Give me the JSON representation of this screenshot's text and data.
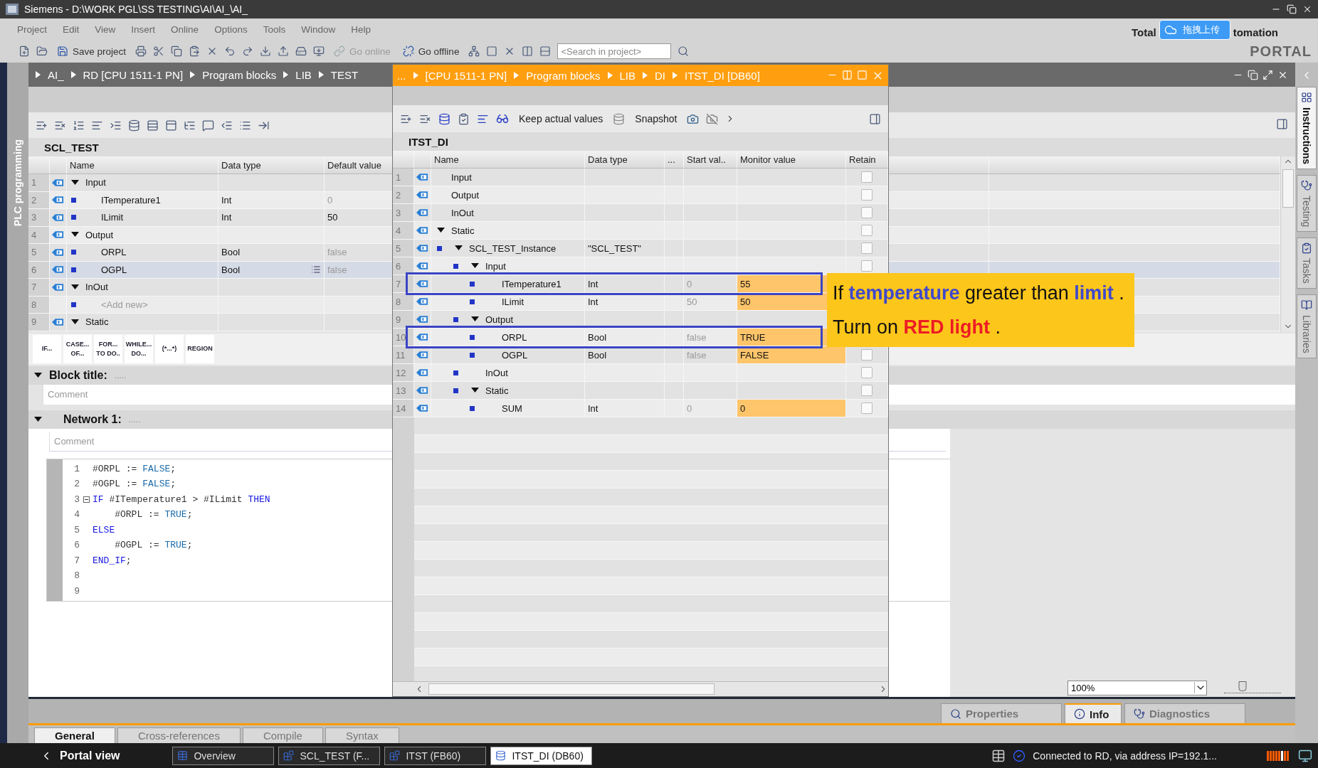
{
  "window": {
    "title": "Siemens - D:\\WORK PGL\\SS TESTING\\AI\\AI_\\AI_"
  },
  "menu": [
    "Project",
    "Edit",
    "View",
    "Insert",
    "Online",
    "Options",
    "Tools",
    "Window",
    "Help"
  ],
  "brand": {
    "left": "Total",
    "right": "tomation",
    "product": "PORTAL"
  },
  "upload_badge": {
    "label": "拖拽上传"
  },
  "toolbar": {
    "buttons": [
      {
        "kind": "save",
        "label": "Save project",
        "disabled": false
      },
      {
        "kind": "online",
        "label": "Go online",
        "disabled": true
      },
      {
        "kind": "offline",
        "label": "Go offline",
        "disabled": false
      }
    ],
    "search": {
      "placeholder": "<Search in project>"
    }
  },
  "side_left": {
    "label": "PLC programming"
  },
  "side_tabs": [
    {
      "kind": "instructions",
      "label": "Instructions",
      "selected": true
    },
    {
      "kind": "testing",
      "label": "Testing",
      "selected": false
    },
    {
      "kind": "tasks",
      "label": "Tasks",
      "selected": false
    },
    {
      "kind": "libraries",
      "label": "Libraries",
      "selected": false
    }
  ],
  "editor": {
    "breadcrumb": [
      "AI_",
      "RD [CPU 1511-1 PN]",
      "Program blocks",
      "LIB",
      "TEST"
    ],
    "block_name": "SCL_TEST",
    "columns": [
      "Name",
      "Data type",
      "Default value"
    ],
    "rows": [
      {
        "number": "1",
        "name": "Input",
        "expanded": true,
        "selected": false,
        "children": [
          {
            "number": "2",
            "kind": "member",
            "name": "ITemperature1",
            "data_type": "Int",
            "default_value": "0",
            "selected": false
          },
          {
            "number": "3",
            "kind": "member",
            "name": "ILimit",
            "data_type": "Int",
            "default_value": "50",
            "selected": false
          }
        ]
      },
      {
        "number": "4",
        "name": "Output",
        "expanded": true,
        "selected": false,
        "children": [
          {
            "number": "5",
            "kind": "member",
            "name": "ORPL",
            "data_type": "Bool",
            "default_value": "false",
            "selected": false
          },
          {
            "number": "6",
            "kind": "member",
            "name": "OGPL",
            "data_type": "Bool",
            "default_value": "false",
            "selected": true
          }
        ]
      },
      {
        "number": "7",
        "name": "InOut",
        "expanded": true,
        "selected": false,
        "children": [
          {
            "number": "8",
            "kind": "add_new",
            "name": "<Add new>",
            "selected": false
          }
        ]
      },
      {
        "number": "9",
        "name": "Static",
        "expanded": true,
        "selected": false
      }
    ],
    "instructions": [
      "IF...",
      "CASE...\nOF...",
      "FOR...\nTO DO..",
      "WHILE...\nDO...",
      "(*...*)",
      "REGION"
    ],
    "block_title": {
      "label": "Block title:",
      "value": ".....",
      "comment_placeholder": "Comment"
    },
    "network": {
      "label": "Network 1:",
      "value": ".....",
      "comment_placeholder": "Comment"
    },
    "code": [
      {
        "number": "1",
        "fold": false,
        "indent": false,
        "tokens": [
          {
            "kind": "var",
            "text": "#ORPL"
          },
          {
            "kind": "plain",
            "text": " := "
          },
          {
            "kind": "const",
            "text": "FALSE"
          },
          {
            "kind": "plain",
            "text": ";"
          }
        ]
      },
      {
        "number": "2",
        "fold": false,
        "indent": false,
        "tokens": [
          {
            "kind": "var",
            "text": "#OGPL"
          },
          {
            "kind": "plain",
            "text": " := "
          },
          {
            "kind": "const",
            "text": "FALSE"
          },
          {
            "kind": "plain",
            "text": ";"
          }
        ]
      },
      {
        "number": "3",
        "fold": true,
        "indent": false,
        "tokens": [
          {
            "kind": "keyword",
            "text": "IF"
          },
          {
            "kind": "var",
            "text": " #ITemperature1"
          },
          {
            "kind": "plain",
            "text": " > "
          },
          {
            "kind": "var",
            "text": "#ILimit"
          },
          {
            "kind": "keyword",
            "text": " THEN"
          }
        ]
      },
      {
        "number": "4",
        "fold": false,
        "indent": true,
        "tokens": [
          {
            "kind": "var",
            "text": "#ORPL"
          },
          {
            "kind": "plain",
            "text": " := "
          },
          {
            "kind": "const",
            "text": "TRUE"
          },
          {
            "kind": "plain",
            "text": ";"
          }
        ]
      },
      {
        "number": "5",
        "fold": false,
        "indent": false,
        "tokens": [
          {
            "kind": "keyword",
            "text": "ELSE"
          }
        ]
      },
      {
        "number": "6",
        "fold": false,
        "indent": true,
        "tokens": [
          {
            "kind": "var",
            "text": "#OGPL"
          },
          {
            "kind": "plain",
            "text": " := "
          },
          {
            "kind": "const",
            "text": "TRUE"
          },
          {
            "kind": "plain",
            "text": ";"
          }
        ]
      },
      {
        "number": "7",
        "fold": false,
        "indent": false,
        "tokens": [
          {
            "kind": "keyword",
            "text": "END_IF"
          },
          {
            "kind": "plain",
            "text": ";"
          }
        ]
      },
      {
        "number": "8",
        "fold": false
      },
      {
        "number": "9",
        "fold": false
      }
    ],
    "zoom": {
      "value": "100%",
      "level": 0.33
    }
  },
  "db_window": {
    "breadcrumb": [
      "...",
      "[CPU 1511-1 PN]",
      "Program blocks",
      "LIB",
      "DI",
      "ITST_DI [DB60]"
    ],
    "toolbar": {
      "keep": "Keep actual values",
      "snapshot": "Snapshot"
    },
    "block_name": "ITST_DI",
    "columns": [
      "Name",
      "Data type",
      "...",
      "Start val..",
      "Monitor value",
      "Retain"
    ],
    "rows": [
      {
        "number": "1",
        "name": "Input",
        "highlighted": false,
        "retain": false
      },
      {
        "number": "2",
        "name": "Output",
        "highlighted": false,
        "retain": false
      },
      {
        "number": "3",
        "name": "InOut",
        "highlighted": false,
        "retain": false
      },
      {
        "number": "4",
        "name": "Static",
        "expanded": true,
        "highlighted": false,
        "retain": false,
        "children": [
          {
            "number": "5",
            "name": "SCL_TEST_Instance",
            "data_type": "\"SCL_TEST\"",
            "expanded": true,
            "highlighted": false,
            "retain": false,
            "children": [
              {
                "number": "6",
                "name": "Input",
                "expanded": true,
                "highlighted": false,
                "retain": false,
                "children": [
                  {
                    "number": "7",
                    "name": "ITemperature1",
                    "data_type": "Int",
                    "start_value": "0",
                    "monitor_value": "55",
                    "highlighted": true
                  },
                  {
                    "number": "8",
                    "name": "ILimit",
                    "data_type": "Int",
                    "start_value": "50",
                    "monitor_value": "50",
                    "highlighted": false
                  }
                ]
              },
              {
                "number": "9",
                "name": "Output",
                "expanded": true,
                "highlighted": false,
                "children": [
                  {
                    "number": "10",
                    "name": "ORPL",
                    "data_type": "Bool",
                    "start_value": "false",
                    "monitor_value": "TRUE",
                    "highlighted": true
                  },
                  {
                    "number": "11",
                    "name": "OGPL",
                    "data_type": "Bool",
                    "start_value": "false",
                    "monitor_value": "FALSE",
                    "highlighted": false,
                    "retain": false
                  }
                ]
              },
              {
                "number": "12",
                "name": "InOut",
                "highlighted": false,
                "retain": false
              },
              {
                "number": "13",
                "name": "Static",
                "expanded": true,
                "highlighted": false,
                "retain": false,
                "children": [
                  {
                    "number": "14",
                    "name": "SUM",
                    "data_type": "Int",
                    "start_value": "0",
                    "monitor_value": "0",
                    "highlighted": false,
                    "retain": false
                  }
                ]
              }
            ]
          }
        ]
      }
    ]
  },
  "callout": {
    "lines": [
      [
        {
          "text": "If "
        },
        {
          "text": "temperature",
          "color": "#3f48cc"
        },
        {
          "text": " greater than "
        },
        {
          "text": "limit",
          "color": "#3f48cc"
        },
        {
          "text": " ."
        }
      ],
      [
        {
          "text": "Turn on "
        },
        {
          "text": "RED light",
          "color": "#ed1c24"
        },
        {
          "text": " ."
        }
      ]
    ]
  },
  "inspector": {
    "tabs": [
      {
        "kind": "properties",
        "label": "Properties",
        "selected": false
      },
      {
        "kind": "info",
        "label": "Info",
        "selected": true
      },
      {
        "kind": "diagnostics",
        "label": "Diagnostics",
        "selected": false
      }
    ],
    "subtabs": [
      {
        "label": "General",
        "selected": true
      },
      {
        "label": "Cross-references",
        "selected": false
      },
      {
        "label": "Compile",
        "selected": false
      },
      {
        "label": "Syntax",
        "selected": false
      }
    ]
  },
  "taskbar": {
    "portal": "Portal view",
    "items": [
      {
        "kind": "overview",
        "label": "Overview",
        "selected": false
      },
      {
        "kind": "block",
        "label": "SCL_TEST (F...",
        "selected": false
      },
      {
        "kind": "block",
        "label": "ITST (FB60)",
        "selected": false
      },
      {
        "kind": "db",
        "label": "ITST_DI (DB60)",
        "selected": true
      }
    ],
    "status": "Connected to RD, via address IP=192.1..."
  }
}
